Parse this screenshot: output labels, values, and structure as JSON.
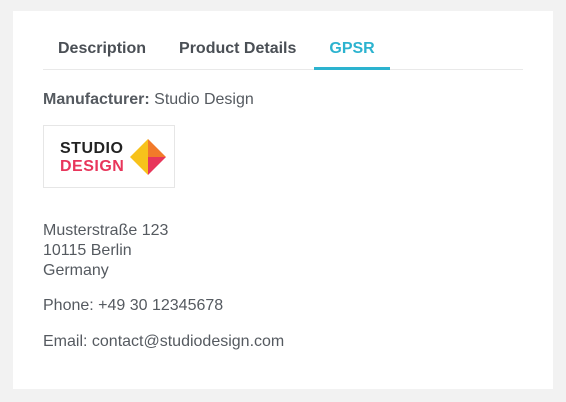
{
  "tabs": [
    {
      "label": "Description",
      "active": false
    },
    {
      "label": "Product Details",
      "active": false
    },
    {
      "label": "GPSR",
      "active": true
    }
  ],
  "manufacturer": {
    "label": "Manufacturer:",
    "value": "Studio Design"
  },
  "logo": {
    "line1": "STUDIO",
    "line2": "DESIGN"
  },
  "address": {
    "street": "Musterstraße 123",
    "city": "10115 Berlin",
    "country": "Germany"
  },
  "phone": "Phone: +49 30 12345678",
  "email": "Email: contact@studiodesign.com",
  "colors": {
    "accent": "#2cb3cf",
    "logo_red": "#e8365b",
    "logo_yellow": "#f7c21b",
    "logo_orange": "#f27a2a"
  }
}
